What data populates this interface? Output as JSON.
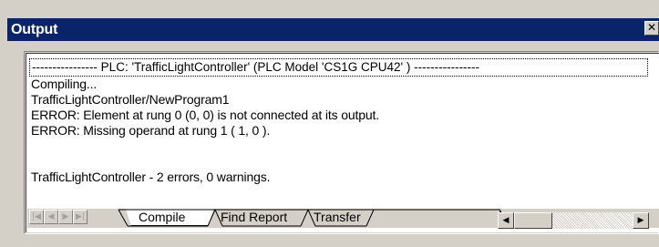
{
  "window": {
    "title": "Output",
    "close_glyph": "✕"
  },
  "output": {
    "header": "---------------- PLC: 'TrafficLightController' (PLC Model 'CS1G CPU42' ) ----------------",
    "lines": [
      "Compiling...",
      "TrafficLightController/NewProgram1",
      "ERROR: Element at rung 0 (0, 0)  is not connected at its output.",
      "ERROR: Missing operand at rung 1 ( 1, 0 ).",
      "",
      "TrafficLightController - 2 errors, 0 warnings."
    ]
  },
  "tabs": [
    {
      "label": "Compile",
      "active": true
    },
    {
      "label": "Find Report",
      "active": false
    },
    {
      "label": "Transfer",
      "active": false
    }
  ],
  "nav": {
    "first_icon": "first-page-icon",
    "prev_icon": "prev-page-icon",
    "next_icon": "next-page-icon",
    "last_icon": "last-page-icon",
    "first_glyph": "|◀",
    "prev_glyph": "◀",
    "next_glyph": "▶",
    "last_glyph": "▶|"
  },
  "scrollbar": {
    "left_glyph": "◀",
    "right_glyph": "▶"
  },
  "colors": {
    "titlebar": "#0a246a",
    "face": "#d4d0c8",
    "content": "#ffffff"
  }
}
